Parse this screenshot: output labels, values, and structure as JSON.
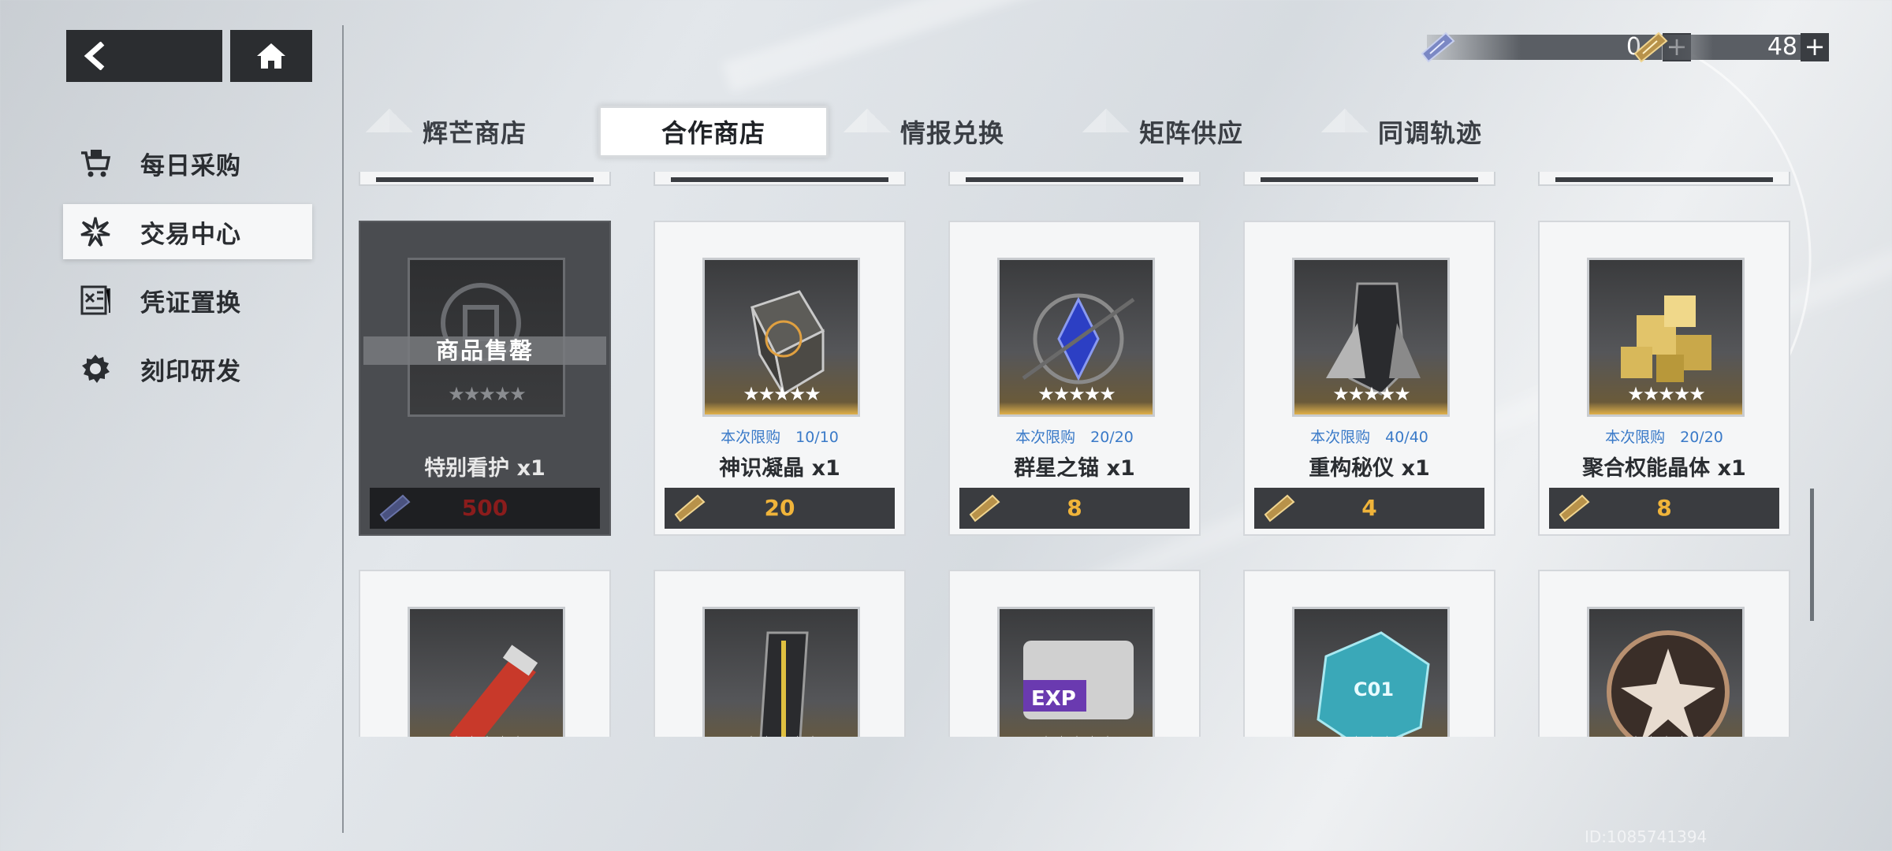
{
  "header": {
    "currencies": [
      {
        "name": "voucher-ticket",
        "value": "0"
      },
      {
        "name": "gold-ticket",
        "value": "48"
      }
    ]
  },
  "sidebar": {
    "items": [
      {
        "label": "每日采购",
        "icon": "cart-icon",
        "active": false
      },
      {
        "label": "交易中心",
        "icon": "exchange-icon",
        "active": true
      },
      {
        "label": "凭证置换",
        "icon": "certificate-icon",
        "active": false
      },
      {
        "label": "刻印研发",
        "icon": "gear-icon",
        "active": false
      }
    ]
  },
  "tabs": [
    {
      "label": "辉芒商店",
      "active": false
    },
    {
      "label": "合作商店",
      "active": true
    },
    {
      "label": "情报兑换",
      "active": false
    },
    {
      "label": "矩阵供应",
      "active": false
    },
    {
      "label": "同调轨迹",
      "active": false
    }
  ],
  "shop": {
    "row1": [
      {
        "name": "特别看护 x1",
        "limit": "",
        "price": "500",
        "sold_out": true,
        "sold_label": "商品售罄",
        "currency": "voucher-ticket"
      },
      {
        "name": "神识凝晶 x1",
        "limit": "本次限购　10/10",
        "price": "20",
        "sold_out": false,
        "currency": "gold-ticket"
      },
      {
        "name": "群星之锚 x1",
        "limit": "本次限购　20/20",
        "price": "8",
        "sold_out": false,
        "currency": "gold-ticket"
      },
      {
        "name": "重构秘仪 x1",
        "limit": "本次限购　40/40",
        "price": "4",
        "sold_out": false,
        "currency": "gold-ticket"
      },
      {
        "name": "聚合权能晶体 x1",
        "limit": "本次限购　20/20",
        "price": "8",
        "sold_out": false,
        "currency": "gold-ticket"
      }
    ],
    "row2_icons": [
      "red-usb-icon",
      "gold-capsule-icon",
      "exp-chip-icon",
      "cyan-cube-icon",
      "emblem-icon"
    ],
    "rarity": "★★★★★",
    "exp_label": "EXP",
    "chip_label": "C01"
  },
  "colors": {
    "accent_gold": "#f0b43a",
    "limit_blue": "#3a7ac8",
    "soldout_red": "#8a1c1c"
  },
  "footer": {
    "uid": "ID:1085741394"
  }
}
